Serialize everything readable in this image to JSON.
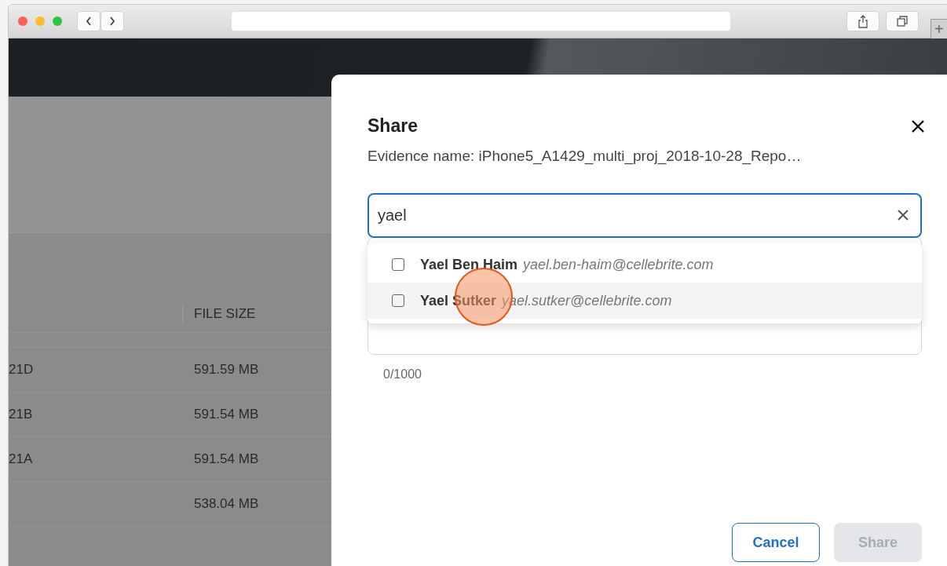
{
  "browser": {
    "new_tab": "+"
  },
  "background_table": {
    "columns": [
      {
        "label": "FILE SIZE"
      }
    ],
    "rows": [
      {
        "column_1": "21D",
        "file_size": "591.59 MB"
      },
      {
        "column_1": "21B",
        "file_size": "591.54 MB"
      },
      {
        "column_1": "21A",
        "file_size": "591.54 MB"
      },
      {
        "column_1": "",
        "file_size": "538.04 MB"
      }
    ]
  },
  "dialog": {
    "title": "Share",
    "evidence": "Evidence name: iPhone5_A1429_multi_proj_2018-10-28_Repo…",
    "search": {
      "value": "yael"
    },
    "suggestions": [
      {
        "name": "Yael Ben Haim",
        "email": "yael.ben-haim@cellebrite.com",
        "checked": false,
        "hovered": false
      },
      {
        "name": "Yael Sutker",
        "email": "yael.sutker@cellebrite.com",
        "checked": false,
        "hovered": true
      }
    ],
    "counter": "0/1000",
    "buttons": [
      {
        "label": "Cancel",
        "kind": "secondary",
        "disabled": false
      },
      {
        "label": "Share",
        "kind": "primary",
        "disabled": true
      }
    ]
  }
}
